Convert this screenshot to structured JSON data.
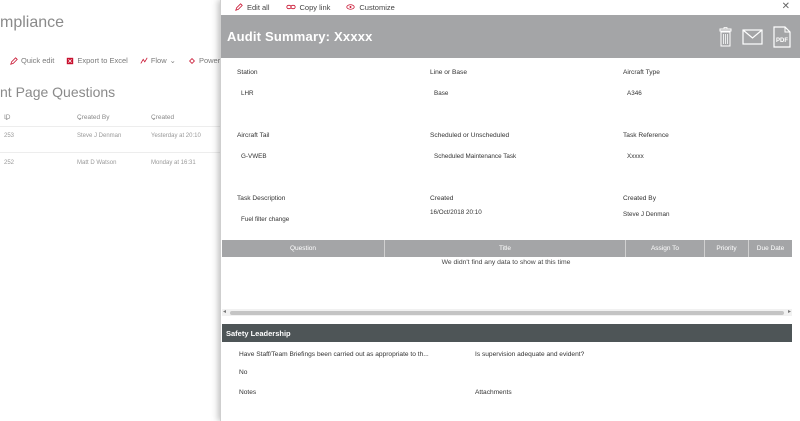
{
  "background": {
    "site_title": "mpliance",
    "toolbar": [
      "Quick edit",
      "Export to Excel",
      "Flow",
      "PowerApps"
    ],
    "page_title": "nt Page Questions",
    "columns": [
      "ID",
      "Created By",
      "Created"
    ],
    "rows": [
      {
        "id": "253",
        "created_by": "Steve J Denman",
        "created": "Yesterday at 20:10"
      },
      {
        "id": "252",
        "created_by": "Matt D Watson",
        "created": "Monday at 16:31"
      }
    ]
  },
  "commands": {
    "edit_all": "Edit all",
    "copy_link": "Copy link",
    "customize": "Customize"
  },
  "header": {
    "title": "Audit Summary: Xxxxx",
    "color": "#a4a5a7"
  },
  "fields": {
    "station": {
      "label": "Station",
      "value": "LHR"
    },
    "line_or_base": {
      "label": "Line or Base",
      "value": "Base"
    },
    "aircraft_type": {
      "label": "Aircraft Type",
      "value": "A346"
    },
    "aircraft_tail": {
      "label": "Aircraft Tail",
      "value": "G-VWEB"
    },
    "scheduled": {
      "label": "Scheduled or Unscheduled",
      "value": "Scheduled Maintenance Task"
    },
    "task_reference": {
      "label": "Task Reference",
      "value": "Xxxxx"
    },
    "task_description": {
      "label": "Task Description",
      "value": "Fuel filter change"
    },
    "created": {
      "label": "Created",
      "value": "16/Oct/2018 20:10"
    },
    "created_by": {
      "label": "Created By",
      "value": "Steve J Denman"
    }
  },
  "grid": {
    "columns": [
      "Question",
      "Title",
      "Assign To",
      "Priority",
      "Due Date"
    ],
    "empty_message": "We didn't find any data to show at this time"
  },
  "section": {
    "title": "Safety Leadership",
    "color": "#4e5557"
  },
  "questions": {
    "q1": "Have Staff/Team Briefings been carried out as appropriate to th...",
    "q1_answer": "No",
    "q2": "Is supervision adequate and evident?",
    "notes": "Notes",
    "attachments": "Attachments"
  }
}
